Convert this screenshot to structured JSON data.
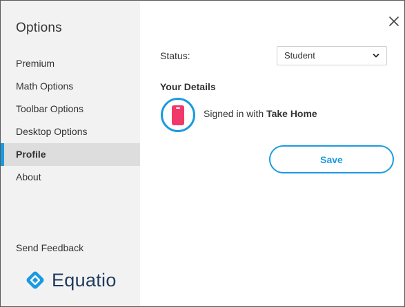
{
  "sidebar": {
    "title": "Options",
    "items": [
      {
        "label": "Premium",
        "active": false
      },
      {
        "label": "Math Options",
        "active": false
      },
      {
        "label": "Toolbar Options",
        "active": false
      },
      {
        "label": "Desktop Options",
        "active": false
      },
      {
        "label": "Profile",
        "active": true
      },
      {
        "label": "About",
        "active": false
      }
    ],
    "feedback_label": "Send Feedback",
    "logo_text": "Equatio"
  },
  "profile": {
    "status_label": "Status:",
    "status_value": "Student",
    "details_heading": "Your Details",
    "signed_in_prefix": "Signed in with",
    "signed_in_provider": "Take Home",
    "save_label": "Save"
  },
  "icons": {
    "close": "close-icon",
    "select": "chevron-down-icon",
    "avatar": "phone-icon",
    "logo": "equatio-logo-icon"
  },
  "colors": {
    "accent": "#1a9ae0",
    "avatar_fill": "#f0386b",
    "logo_text": "#1f3a5c",
    "sidebar_bg": "#f2f2f2",
    "active_bg": "#dddddd"
  }
}
